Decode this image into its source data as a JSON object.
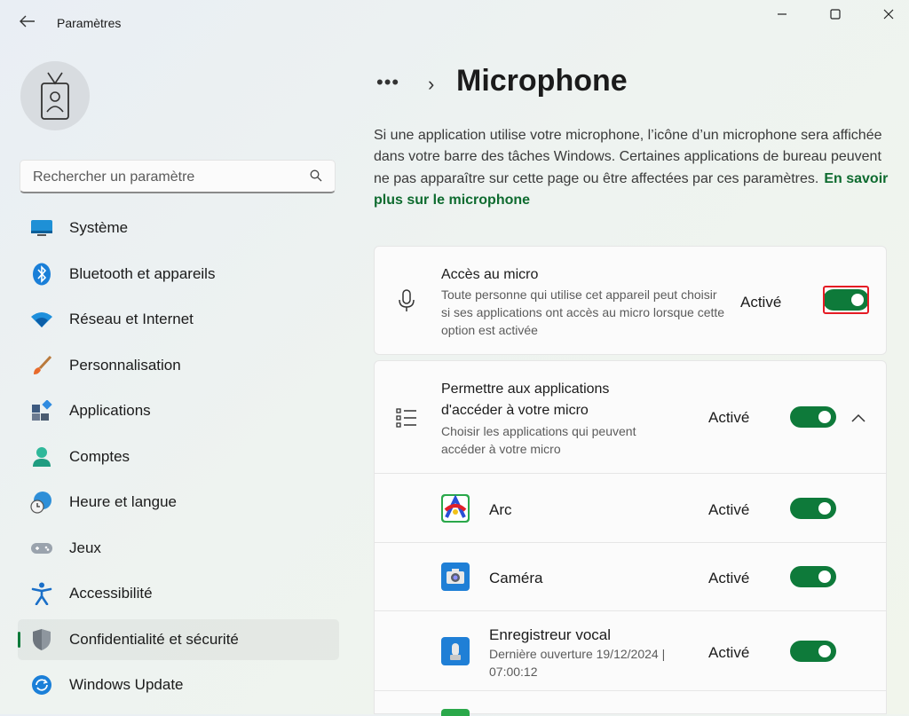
{
  "window": {
    "title": "Paramètres",
    "controls": {
      "minimize": "—",
      "maximize": "☐",
      "close": "✕"
    }
  },
  "search": {
    "placeholder": "Rechercher un paramètre"
  },
  "sidebar": {
    "items": [
      {
        "label": "Système",
        "icon": "monitor-icon",
        "selected": false
      },
      {
        "label": "Bluetooth et appareils",
        "icon": "bluetooth-icon",
        "selected": false
      },
      {
        "label": "Réseau et Internet",
        "icon": "wifi-icon",
        "selected": false
      },
      {
        "label": "Personnalisation",
        "icon": "paintbrush-icon",
        "selected": false
      },
      {
        "label": "Applications",
        "icon": "apps-icon",
        "selected": false
      },
      {
        "label": "Comptes",
        "icon": "person-icon",
        "selected": false
      },
      {
        "label": "Heure et langue",
        "icon": "globe-clock-icon",
        "selected": false
      },
      {
        "label": "Jeux",
        "icon": "gamepad-icon",
        "selected": false
      },
      {
        "label": "Accessibilité",
        "icon": "accessibility-icon",
        "selected": false
      },
      {
        "label": "Confidentialité et sécurité",
        "icon": "shield-icon",
        "selected": true
      },
      {
        "label": "Windows Update",
        "icon": "update-icon",
        "selected": false
      }
    ]
  },
  "breadcrumb": {
    "ellipsis": "•••",
    "separator": "›"
  },
  "page": {
    "title": "Microphone",
    "description": "Si une application utilise votre microphone, l’icône d’un microphone sera affichée dans votre barre des tâches Windows. Certaines applications de bureau peuvent ne pas apparaître sur cette page ou être affectées par ces paramètres.",
    "learn_more": "En savoir plus sur le microphone"
  },
  "settings": {
    "mic_access": {
      "title": "Accès au micro",
      "subtitle": "Toute personne qui utilise cet appareil peut choisir si ses applications ont accès au micro lorsque cette option est activée",
      "state": "Activé",
      "on": true
    },
    "apps_access": {
      "title": "Permettre aux applications d'accéder à votre micro",
      "subtitle": "Choisir les applications qui peuvent accéder à votre micro",
      "state": "Activé",
      "on": true,
      "expand_icon": "chevron-up-icon"
    },
    "apps": [
      {
        "name": "Arc",
        "state": "Activé",
        "on": true,
        "detail": ""
      },
      {
        "name": "Caméra",
        "state": "Activé",
        "on": true,
        "detail": ""
      },
      {
        "name": "Enregistreur vocal",
        "state": "Activé",
        "on": true,
        "detail": "Dernière ouverture 19/12/2024 | 07:00:12"
      }
    ]
  },
  "colors": {
    "accent": "#0e7a3a",
    "highlight": "#e51b24",
    "link": "#0e6b2f"
  }
}
